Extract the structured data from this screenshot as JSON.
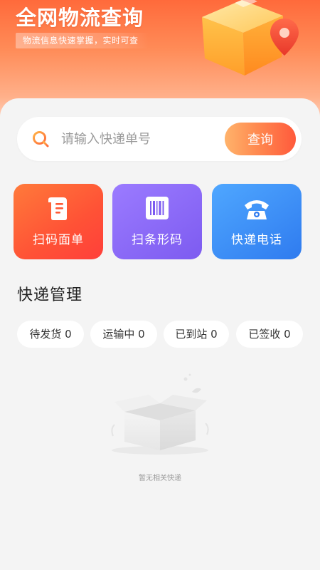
{
  "header": {
    "title": "全网物流查询",
    "subtitle": "物流信息快速掌握，实时可查"
  },
  "search": {
    "placeholder": "请输入快递单号",
    "value": "",
    "button_label": "查询"
  },
  "tools": [
    {
      "label": "扫码面单",
      "icon": "document-icon"
    },
    {
      "label": "扫条形码",
      "icon": "barcode-icon"
    },
    {
      "label": "快递电话",
      "icon": "telephone-icon"
    }
  ],
  "management": {
    "title": "快递管理",
    "tabs": [
      {
        "label": "待发货",
        "count": "0"
      },
      {
        "label": "运输中",
        "count": "0"
      },
      {
        "label": "已到站",
        "count": "0"
      },
      {
        "label": "已签收",
        "count": "0"
      }
    ]
  },
  "empty_state": {
    "text": "暂无相关快递",
    "icon": "empty-box-icon"
  },
  "colors": {
    "header_start": "#ff6a3b",
    "header_end": "#ffd3c0",
    "search_button_start": "#ffb36b",
    "search_button_end": "#ff5a3c",
    "scan_waybill": "#ff5236",
    "scan_barcode": "#7d5bf0",
    "express_phone": "#2f7bef"
  }
}
